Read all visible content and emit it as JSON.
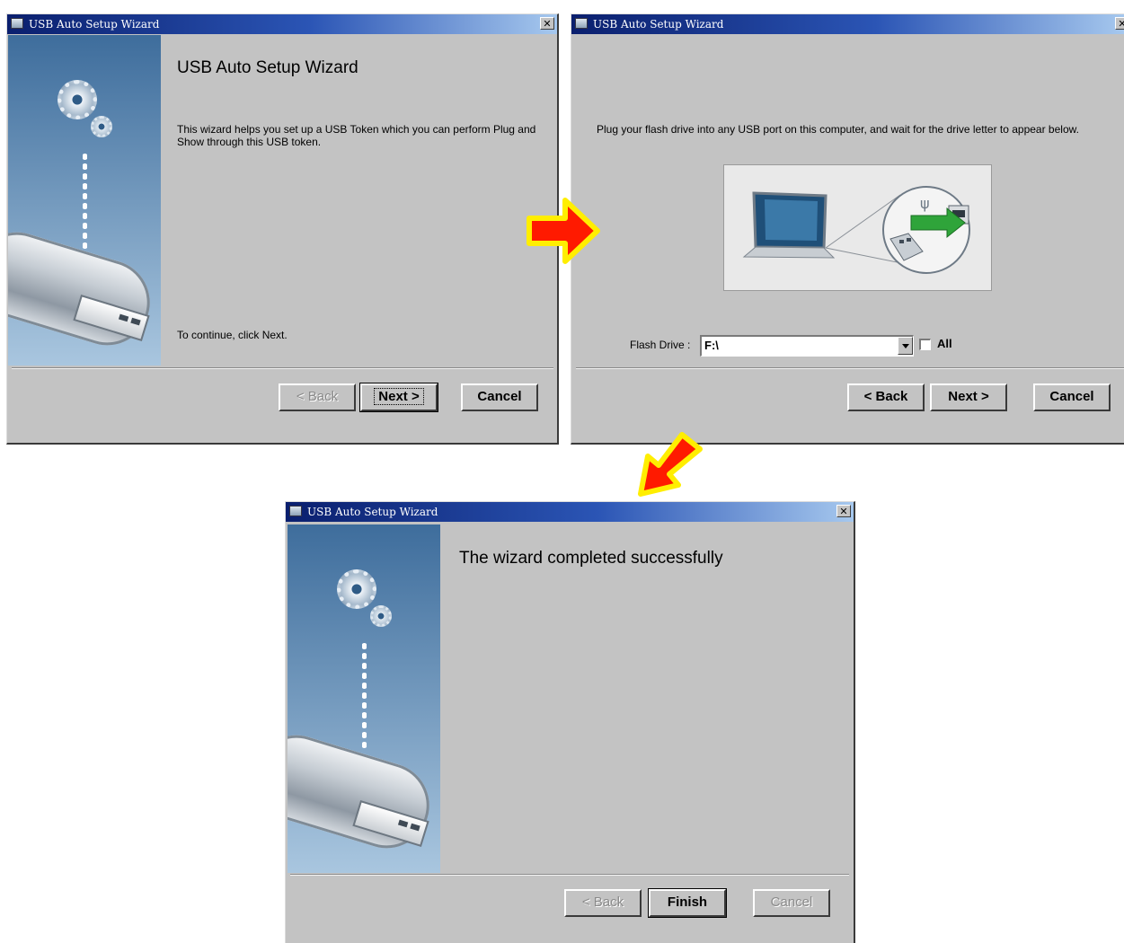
{
  "colors": {
    "title_bar": "#2b55b5",
    "arrow_fill": "#ff1a00",
    "arrow_outline": "#ffee00",
    "window_bg": "#c3c3c3"
  },
  "window1": {
    "title": "USB Auto Setup Wizard",
    "close_glyph": "✕",
    "heading": "USB Auto Setup Wizard",
    "intro": "This wizard helps you set up a USB Token which you can perform Plug and Show through this USB token.",
    "footer_hint": "To continue, click Next.",
    "back_label": "< Back",
    "next_label": "Next >",
    "cancel_label": "Cancel"
  },
  "window2": {
    "title": "USB Auto Setup Wizard",
    "close_glyph": "✕",
    "instruction": "Plug your flash drive into any USB port on this computer, and wait for the drive letter to appear below.",
    "flash_drive_label": "Flash Drive :",
    "flash_drive_value": "F:\\",
    "all_label": "All",
    "back_label": "< Back",
    "next_label": "Next >",
    "cancel_label": "Cancel"
  },
  "window3": {
    "title": "USB Auto Setup Wizard",
    "close_glyph": "✕",
    "heading": "The wizard completed successfully",
    "back_label": "< Back",
    "finish_label": "Finish",
    "cancel_label": "Cancel"
  },
  "icons": [
    "app-icon",
    "close-icon",
    "gear-icon",
    "usb-drive-icon",
    "laptop-icon",
    "usb-port-icon",
    "dropdown-arrow-icon",
    "arrow-right-icon",
    "arrow-down-left-icon"
  ]
}
